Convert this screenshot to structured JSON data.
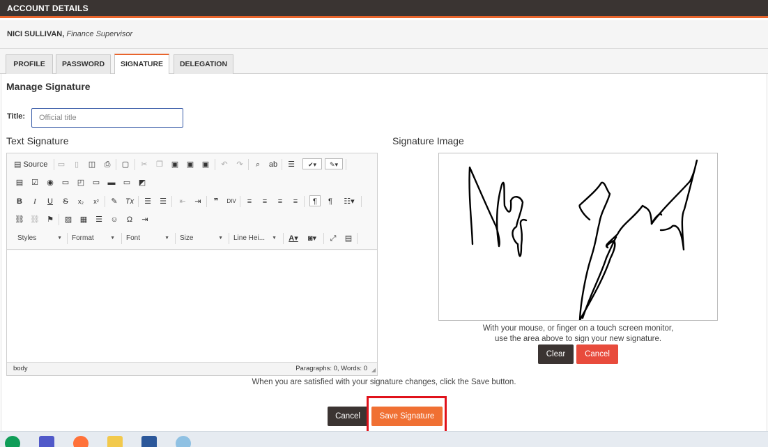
{
  "header": {
    "title": "ACCOUNT DETAILS"
  },
  "user": {
    "name": "NICI SULLIVAN",
    "role": "Finance Supervisor"
  },
  "tabs": [
    {
      "label": "PROFILE",
      "active": false
    },
    {
      "label": "PASSWORD",
      "active": false
    },
    {
      "label": "SIGNATURE",
      "active": true
    },
    {
      "label": "DELEGATION",
      "active": false
    }
  ],
  "section": {
    "heading": "Manage Signature",
    "title_label": "Title:",
    "title_value": "Official title",
    "text_signature_heading": "Text Signature",
    "signature_image_heading": "Signature Image"
  },
  "editor": {
    "source_label": "Source",
    "combos": [
      "Styles",
      "Format",
      "Font",
      "Size",
      "Line Hei..."
    ],
    "status_path": "body",
    "status_count": "Paragraphs: 0, Words: 0"
  },
  "signature_pad": {
    "help_line1": "With your mouse, or finger on a touch screen monitor,",
    "help_line2": "use the area above to sign your new signature.",
    "clear_label": "Clear",
    "cancel_label": "Cancel"
  },
  "footer": {
    "hint": "When you are satisfied with your signature changes, click the Save button.",
    "cancel_label": "Cancel",
    "save_label": "Save Signature"
  },
  "colors": {
    "accent": "#e8642c",
    "header_bg": "#3a3432",
    "danger": "#e84b3c",
    "save": "#f07033",
    "highlight": "#e0121b"
  },
  "taskbar_icons": [
    "hangouts-icon",
    "teams-icon",
    "firefox-icon",
    "file-explorer-icon",
    "word-icon",
    "paint-icon"
  ]
}
